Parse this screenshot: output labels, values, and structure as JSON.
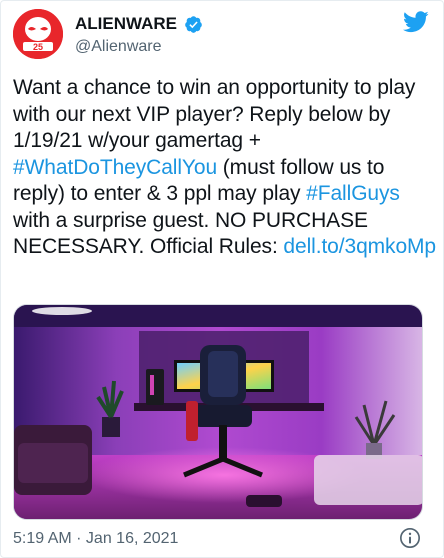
{
  "account": {
    "display_name": "ALIENWARE",
    "handle": "@Alienware",
    "avatar_text": "25",
    "verified": true
  },
  "tweet": {
    "text_segments": [
      {
        "text": "Want a chance to win an opportunity to play with our next VIP player? Reply below by 1/19/21 w/your gamertag + ",
        "link": false
      },
      {
        "text": "#WhatDoTheyCallYou",
        "link": true
      },
      {
        "text": " (must follow us to reply) to enter & 3 ppl may play ",
        "link": false
      },
      {
        "text": "#FallGuys",
        "link": true
      },
      {
        "text": " with a surprise guest. NO PURCHASE NECESSARY. Official Rules: ",
        "link": false
      },
      {
        "text": "dell.to/3qmkoMp",
        "link": true
      }
    ],
    "timestamp": "5:19 AM · Jan 16, 2021"
  },
  "icons": {
    "verified": "verified-badge-icon",
    "brand": "twitter-bird-icon",
    "info": "info-icon",
    "media": "gaming-room-photo"
  },
  "colors": {
    "link": "#1b95e0",
    "brand": "#1da1f2",
    "avatar": "#e8262b",
    "muted": "#536471"
  }
}
